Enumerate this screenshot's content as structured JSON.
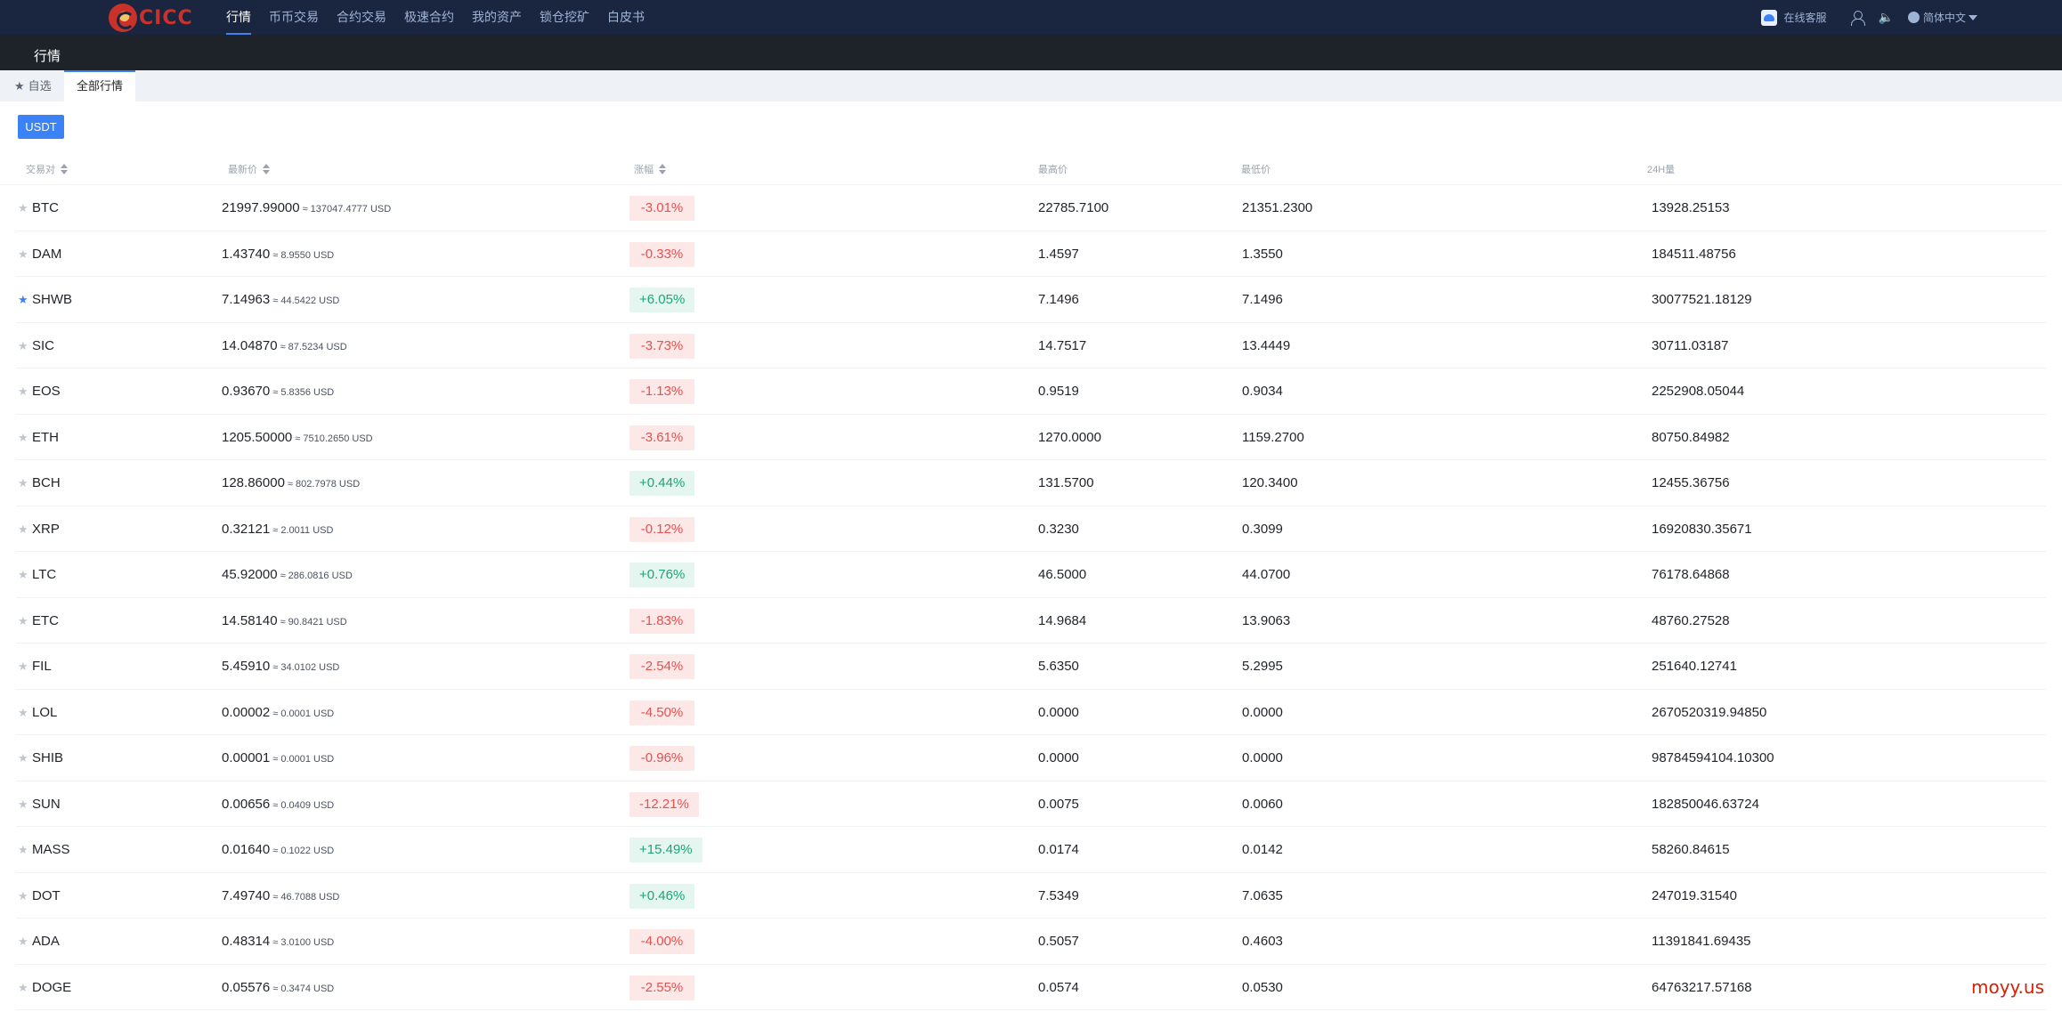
{
  "nav": {
    "logo_text": "CICC",
    "items": [
      "行情",
      "币币交易",
      "合约交易",
      "极速合约",
      "我的资产",
      "锁仓挖矿",
      "白皮书"
    ],
    "service": "在线客服",
    "language": "简体中文"
  },
  "subheader": {
    "title": "行情"
  },
  "tabs": {
    "favorites": "自选",
    "all": "全部行情"
  },
  "quote_button": "USDT",
  "table": {
    "headers": {
      "pair": "交易对",
      "last": "最新价",
      "change": "涨幅",
      "high": "最高价",
      "low": "最低价",
      "volume": "24H量"
    },
    "rows": [
      {
        "pair": "BTC",
        "price": "21997.99000",
        "usd": "≈ 137047.4777 USD",
        "change": "-3.01%",
        "high": "22785.7100",
        "low": "21351.2300",
        "volume": "13928.25153"
      },
      {
        "pair": "DAM",
        "price": "1.43740",
        "usd": "≈ 8.9550 USD",
        "change": "-0.33%",
        "high": "1.4597",
        "low": "1.3550",
        "volume": "184511.48756"
      },
      {
        "pair": "SHWB",
        "price": "7.14963",
        "usd": "≈ 44.5422 USD",
        "change": "+6.05%",
        "high": "7.1496",
        "low": "7.1496",
        "volume": "30077521.18129",
        "starred": true
      },
      {
        "pair": "SIC",
        "price": "14.04870",
        "usd": "≈ 87.5234 USD",
        "change": "-3.73%",
        "high": "14.7517",
        "low": "13.4449",
        "volume": "30711.03187"
      },
      {
        "pair": "EOS",
        "price": "0.93670",
        "usd": "≈ 5.8356 USD",
        "change": "-1.13%",
        "high": "0.9519",
        "low": "0.9034",
        "volume": "2252908.05044"
      },
      {
        "pair": "ETH",
        "price": "1205.50000",
        "usd": "≈ 7510.2650 USD",
        "change": "-3.61%",
        "high": "1270.0000",
        "low": "1159.2700",
        "volume": "80750.84982"
      },
      {
        "pair": "BCH",
        "price": "128.86000",
        "usd": "≈ 802.7978 USD",
        "change": "+0.44%",
        "high": "131.5700",
        "low": "120.3400",
        "volume": "12455.36756"
      },
      {
        "pair": "XRP",
        "price": "0.32121",
        "usd": "≈ 2.0011 USD",
        "change": "-0.12%",
        "high": "0.3230",
        "low": "0.3099",
        "volume": "16920830.35671"
      },
      {
        "pair": "LTC",
        "price": "45.92000",
        "usd": "≈ 286.0816 USD",
        "change": "+0.76%",
        "high": "46.5000",
        "low": "44.0700",
        "volume": "76178.64868"
      },
      {
        "pair": "ETC",
        "price": "14.58140",
        "usd": "≈ 90.8421 USD",
        "change": "-1.83%",
        "high": "14.9684",
        "low": "13.9063",
        "volume": "48760.27528"
      },
      {
        "pair": "FIL",
        "price": "5.45910",
        "usd": "≈ 34.0102 USD",
        "change": "-2.54%",
        "high": "5.6350",
        "low": "5.2995",
        "volume": "251640.12741"
      },
      {
        "pair": "LOL",
        "price": "0.00002",
        "usd": "≈ 0.0001 USD",
        "change": "-4.50%",
        "high": "0.0000",
        "low": "0.0000",
        "volume": "2670520319.94850"
      },
      {
        "pair": "SHIB",
        "price": "0.00001",
        "usd": "≈ 0.0001 USD",
        "change": "-0.96%",
        "high": "0.0000",
        "low": "0.0000",
        "volume": "98784594104.10300"
      },
      {
        "pair": "SUN",
        "price": "0.00656",
        "usd": "≈ 0.0409 USD",
        "change": "-12.21%",
        "high": "0.0075",
        "low": "0.0060",
        "volume": "182850046.63724"
      },
      {
        "pair": "MASS",
        "price": "0.01640",
        "usd": "≈ 0.1022 USD",
        "change": "+15.49%",
        "high": "0.0174",
        "low": "0.0142",
        "volume": "58260.84615"
      },
      {
        "pair": "DOT",
        "price": "7.49740",
        "usd": "≈ 46.7088 USD",
        "change": "+0.46%",
        "high": "7.5349",
        "low": "7.0635",
        "volume": "247019.31540"
      },
      {
        "pair": "ADA",
        "price": "0.48314",
        "usd": "≈ 3.0100 USD",
        "change": "-4.00%",
        "high": "0.5057",
        "low": "0.4603",
        "volume": "11391841.69435"
      },
      {
        "pair": "DOGE",
        "price": "0.05576",
        "usd": "≈ 0.3474 USD",
        "change": "-2.55%",
        "high": "0.0574",
        "low": "0.0530",
        "volume": "64763217.57168"
      }
    ]
  },
  "colors": {
    "up": "#1fa37a",
    "down": "#e45151",
    "accent": "#3b82f6",
    "nav_bg": "#1a2540"
  },
  "watermark": "moyy.us"
}
